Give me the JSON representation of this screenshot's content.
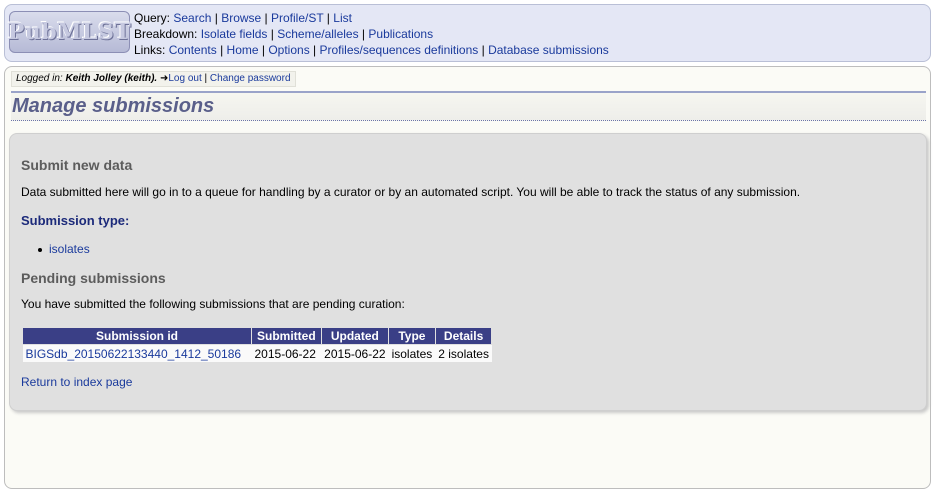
{
  "menu": {
    "logo_text": "PubMLST",
    "query_label": "Query:",
    "query_links": [
      "Search",
      "Browse",
      "Profile/ST",
      "List"
    ],
    "breakdown_label": "Breakdown:",
    "breakdown_links": [
      "Isolate fields",
      "Scheme/alleles",
      "Publications"
    ],
    "links_label": "Links:",
    "links_links": [
      "Contents",
      "Home",
      "Options",
      "Profiles/sequences definitions",
      "Database submissions"
    ]
  },
  "login": {
    "prefix": "Logged in:",
    "user": "Keith Jolley (keith).",
    "logout": "Log out",
    "separator": "|",
    "change_password": "Change password"
  },
  "page_title": "Manage submissions",
  "submit": {
    "heading": "Submit new data",
    "description": "Data submitted here will go in to a queue for handling by a curator or by an automated script. You will be able to track the status of any submission.",
    "type_heading": "Submission type:",
    "types": [
      "isolates"
    ]
  },
  "pending": {
    "heading": "Pending submissions",
    "description": "You have submitted the following submissions that are pending curation:",
    "columns": [
      "Submission id",
      "Submitted",
      "Updated",
      "Type",
      "Details"
    ],
    "rows": [
      {
        "id": "BIGSdb_20150622133440_1412_50186",
        "submitted": "2015-06-22",
        "updated": "2015-06-22",
        "type": "isolates",
        "details": "2 isolates"
      }
    ]
  },
  "return_link": "Return to index page",
  "colors": {
    "menu_bg": "#e4e7f5",
    "link": "#1a3a9c",
    "table_header": "#3a3f86",
    "title": "#5a5f8a"
  }
}
